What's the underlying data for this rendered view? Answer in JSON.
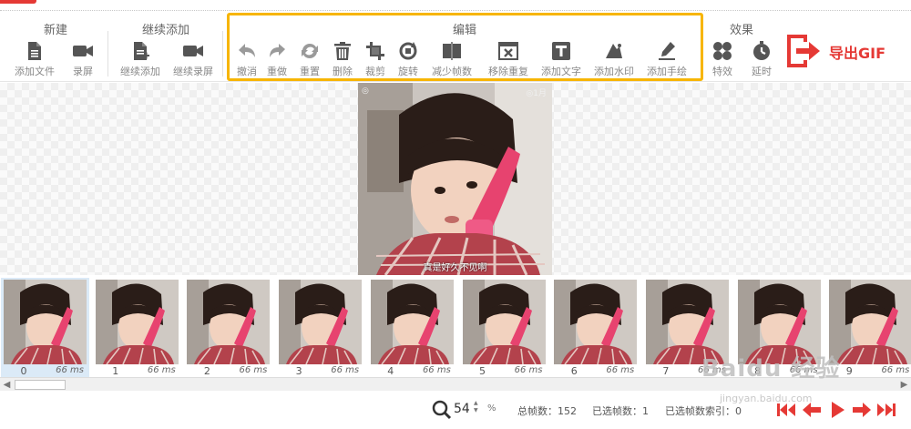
{
  "ribbon": {
    "groups": {
      "new": {
        "title": "新建",
        "items": [
          "添加文件",
          "录屏"
        ]
      },
      "continue": {
        "title": "继续添加",
        "items": [
          "继续添加",
          "继续录屏"
        ]
      },
      "edit": {
        "title": "编辑",
        "items": [
          "撤消",
          "重做",
          "重置",
          "删除",
          "裁剪",
          "旋转",
          "减少帧数",
          "移除重复",
          "添加文字",
          "添加水印",
          "添加手绘"
        ]
      },
      "effects": {
        "title": "效果",
        "items": [
          "特效",
          "延时"
        ]
      }
    },
    "export_label": "导出GIF",
    "highlight_color": "#f7b500",
    "accent_color": "#e53935"
  },
  "preview": {
    "caption": "真是好久不见啊",
    "watermark_right": "◎1月"
  },
  "frames": [
    {
      "index": "0",
      "duration": "66 ms",
      "selected": true
    },
    {
      "index": "1",
      "duration": "66 ms"
    },
    {
      "index": "2",
      "duration": "66 ms"
    },
    {
      "index": "3",
      "duration": "66 ms"
    },
    {
      "index": "4",
      "duration": "66 ms"
    },
    {
      "index": "5",
      "duration": "66 ms"
    },
    {
      "index": "6",
      "duration": "66 ms"
    },
    {
      "index": "7",
      "duration": "66 ms"
    },
    {
      "index": "8",
      "duration": "66 ms"
    },
    {
      "index": "9",
      "duration": "66 ms"
    }
  ],
  "status": {
    "zoom": "54",
    "zoom_unit": "%",
    "total_frames": "总帧数：152",
    "selected_frames": "已选帧数：1",
    "selected_index": "已选帧数索引：0"
  },
  "watermark": {
    "big": "Baidu 经验",
    "small": "jingyan.baidu.com"
  }
}
